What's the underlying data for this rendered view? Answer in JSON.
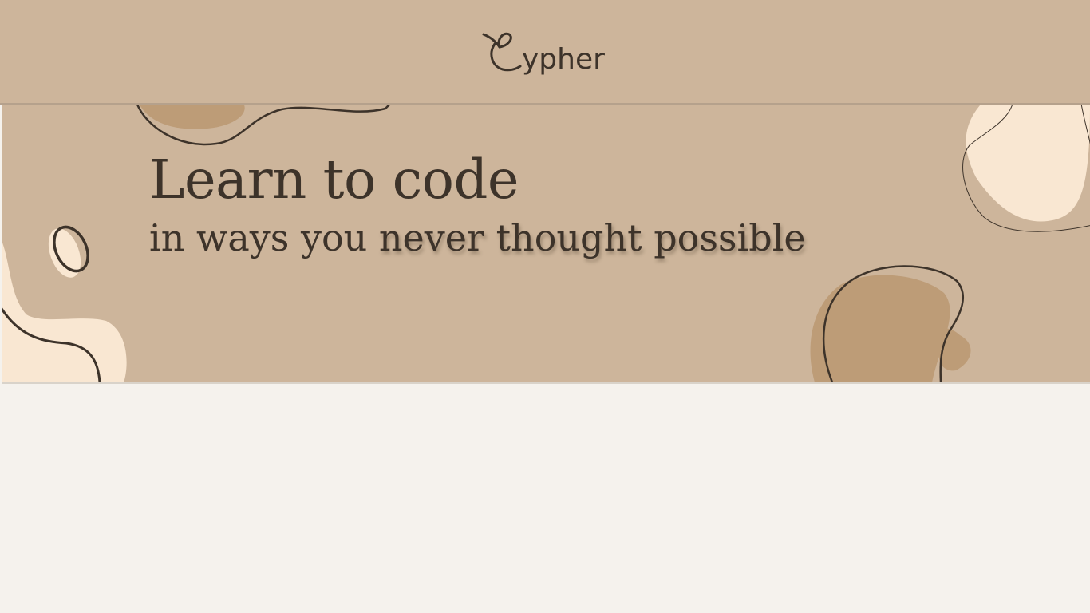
{
  "header": {
    "logo_alt": "Cypher",
    "logo_text": "ypher"
  },
  "hero": {
    "headline": "Learn to code",
    "subline_plain": "in ways you ",
    "subline_emphasis": "never thought possible"
  },
  "colors": {
    "background": "#f5f2ed",
    "hero": "#cdb59b",
    "blob_dark": "#bd9c77",
    "blob_light": "#f9e7d2",
    "ink": "#3d332a"
  }
}
